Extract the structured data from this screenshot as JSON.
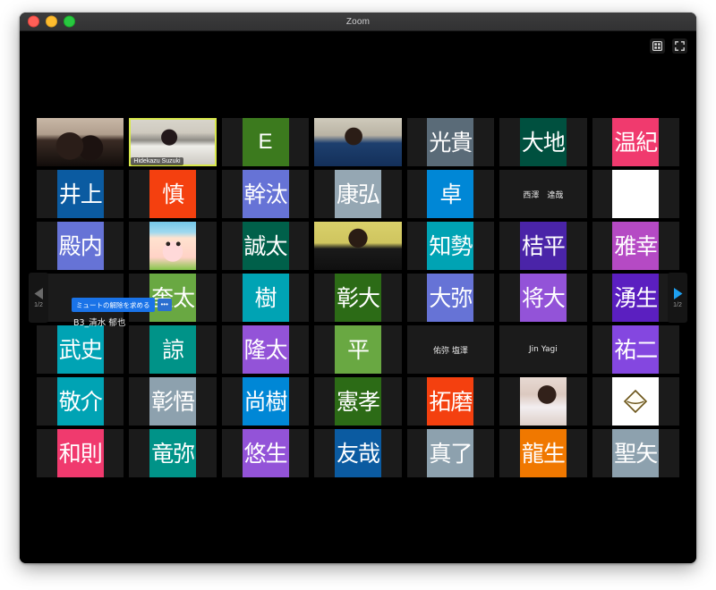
{
  "window": {
    "title": "Zoom",
    "traffic_lights": [
      "close",
      "minimize",
      "maximize"
    ]
  },
  "topbar": {
    "view_button_label": "view-grid",
    "fullscreen_button_label": "enter-full-screen"
  },
  "navigation": {
    "prev_label": "◀",
    "next_label": "▶",
    "page_indicator": "1/2",
    "prev_enabled": false,
    "next_enabled": true
  },
  "hover_tile": {
    "ask_to_unmute": "ミュートの解除を求める",
    "more_options": "•••",
    "participant_name": "B3_清水 郁也"
  },
  "gallery": {
    "columns": 7,
    "rows": 7,
    "participants": [
      {
        "id": "r1c1",
        "type": "video",
        "photo": "ph-a",
        "label": "",
        "colors": {}
      },
      {
        "id": "r1c2",
        "type": "video",
        "photo": "ph-b",
        "label": "Hidekazu Suzuki",
        "speaking": true
      },
      {
        "id": "r1c3",
        "type": "avatar",
        "initials": "E",
        "bg": "#3c7a1e",
        "fg": "#ffffff",
        "latin": true
      },
      {
        "id": "r1c4",
        "type": "video",
        "photo": "ph-c",
        "label": ""
      },
      {
        "id": "r1c5",
        "type": "avatar",
        "initials": "光貴",
        "bg": "#5a6b78",
        "fg": "#ffffff"
      },
      {
        "id": "r1c6",
        "type": "avatar",
        "initials": "大地",
        "bg": "#00503f",
        "fg": "#ffffff"
      },
      {
        "id": "r1c7",
        "type": "avatar",
        "initials": "温紀",
        "bg": "#f03a6e",
        "fg": "#ffffff"
      },
      {
        "id": "r2c1",
        "type": "avatar",
        "initials": "井上",
        "bg": "#0b5ba1",
        "fg": "#ffffff"
      },
      {
        "id": "r2c2",
        "type": "avatar",
        "initials": "慎",
        "bg": "#f4400f",
        "fg": "#ffffff"
      },
      {
        "id": "r2c3",
        "type": "avatar",
        "initials": "幹汰",
        "bg": "#6673d6",
        "fg": "#ffffff"
      },
      {
        "id": "r2c4",
        "type": "avatar",
        "initials": "康弘",
        "bg": "#95a7b3",
        "fg": "#ffffff"
      },
      {
        "id": "r2c5",
        "type": "avatar",
        "initials": "卓",
        "bg": "#0087d6",
        "fg": "#ffffff"
      },
      {
        "id": "r2c6",
        "type": "name",
        "name": "西澤　達哉"
      },
      {
        "id": "r2c7",
        "type": "avatar",
        "initials": "",
        "bg": "#ffffff",
        "fg": "#ffffff"
      },
      {
        "id": "r3c1",
        "type": "avatar",
        "initials": "殿内",
        "bg": "#6673d6",
        "fg": "#ffffff"
      },
      {
        "id": "r3c2",
        "type": "video",
        "photo": "ph-mascot",
        "label": ""
      },
      {
        "id": "r3c3",
        "type": "avatar",
        "initials": "誠太",
        "bg": "#00604a",
        "fg": "#ffffff"
      },
      {
        "id": "r3c4",
        "type": "video",
        "photo": "ph-d",
        "label": ""
      },
      {
        "id": "r3c5",
        "type": "avatar",
        "initials": "知勢",
        "bg": "#00a3b4",
        "fg": "#ffffff"
      },
      {
        "id": "r3c6",
        "type": "avatar",
        "initials": "桔平",
        "bg": "#4a24a8",
        "fg": "#ffffff"
      },
      {
        "id": "r3c7",
        "type": "avatar",
        "initials": "雅幸",
        "bg": "#b54ac4",
        "fg": "#ffffff"
      },
      {
        "id": "r4c1",
        "type": "name",
        "name": "B3_清水 郁也",
        "hovered": true
      },
      {
        "id": "r4c2",
        "type": "avatar",
        "initials": "奎太",
        "bg": "#69a842",
        "fg": "#ffffff"
      },
      {
        "id": "r4c3",
        "type": "avatar",
        "initials": "樹",
        "bg": "#00a3b4",
        "fg": "#ffffff"
      },
      {
        "id": "r4c4",
        "type": "avatar",
        "initials": "彰大",
        "bg": "#2c6b16",
        "fg": "#ffffff"
      },
      {
        "id": "r4c5",
        "type": "avatar",
        "initials": "大弥",
        "bg": "#6673d6",
        "fg": "#ffffff"
      },
      {
        "id": "r4c6",
        "type": "avatar",
        "initials": "将大",
        "bg": "#9353d8",
        "fg": "#ffffff"
      },
      {
        "id": "r4c7",
        "type": "avatar",
        "initials": "湧生",
        "bg": "#5b1fc0",
        "fg": "#ffffff"
      },
      {
        "id": "r5c1",
        "type": "avatar",
        "initials": "武史",
        "bg": "#00a3b4",
        "fg": "#ffffff"
      },
      {
        "id": "r5c2",
        "type": "avatar",
        "initials": "諒",
        "bg": "#009388",
        "fg": "#ffffff"
      },
      {
        "id": "r5c3",
        "type": "avatar",
        "initials": "隆太",
        "bg": "#9353d8",
        "fg": "#ffffff"
      },
      {
        "id": "r5c4",
        "type": "avatar",
        "initials": "平",
        "bg": "#69a842",
        "fg": "#ffffff"
      },
      {
        "id": "r5c5",
        "type": "name",
        "name": "佑弥 塩澤"
      },
      {
        "id": "r5c6",
        "type": "name",
        "name": "Jin Yagi"
      },
      {
        "id": "r5c7",
        "type": "avatar",
        "initials": "祐二",
        "bg": "#8447e0",
        "fg": "#ffffff"
      },
      {
        "id": "r6c1",
        "type": "avatar",
        "initials": "敬介",
        "bg": "#00a3b4",
        "fg": "#ffffff"
      },
      {
        "id": "r6c2",
        "type": "avatar",
        "initials": "彰悟",
        "bg": "#8da1ae",
        "fg": "#ffffff"
      },
      {
        "id": "r6c3",
        "type": "avatar",
        "initials": "尚樹",
        "bg": "#0087d6",
        "fg": "#ffffff"
      },
      {
        "id": "r6c4",
        "type": "avatar",
        "initials": "憲孝",
        "bg": "#2c6b16",
        "fg": "#ffffff"
      },
      {
        "id": "r6c5",
        "type": "avatar",
        "initials": "拓磨",
        "bg": "#f4400f",
        "fg": "#ffffff"
      },
      {
        "id": "r6c6",
        "type": "video",
        "photo": "ph-e",
        "label": ""
      },
      {
        "id": "r6c7",
        "type": "logo",
        "logo": "diamond-envelope-logo",
        "bg": "#ffffff"
      },
      {
        "id": "r7c1",
        "type": "avatar",
        "initials": "和則",
        "bg": "#f03a6e",
        "fg": "#ffffff"
      },
      {
        "id": "r7c2",
        "type": "avatar",
        "initials": "竜弥",
        "bg": "#009388",
        "fg": "#ffffff"
      },
      {
        "id": "r7c3",
        "type": "avatar",
        "initials": "悠生",
        "bg": "#9353d8",
        "fg": "#ffffff"
      },
      {
        "id": "r7c4",
        "type": "avatar",
        "initials": "友哉",
        "bg": "#0b5ba1",
        "fg": "#ffffff"
      },
      {
        "id": "r7c5",
        "type": "avatar",
        "initials": "真了",
        "bg": "#8da1ae",
        "fg": "#ffffff"
      },
      {
        "id": "r7c6",
        "type": "avatar",
        "initials": "龍生",
        "bg": "#f07800",
        "fg": "#ffffff"
      },
      {
        "id": "r7c7",
        "type": "avatar",
        "initials": "聖矢",
        "bg": "#8da1ae",
        "fg": "#ffffff"
      }
    ]
  },
  "colors": {
    "stage_bg": "#000000",
    "tile_bg": "#1b1b1b",
    "accent_blue": "#1a73e8",
    "speaking_border": "#d8e84a"
  }
}
